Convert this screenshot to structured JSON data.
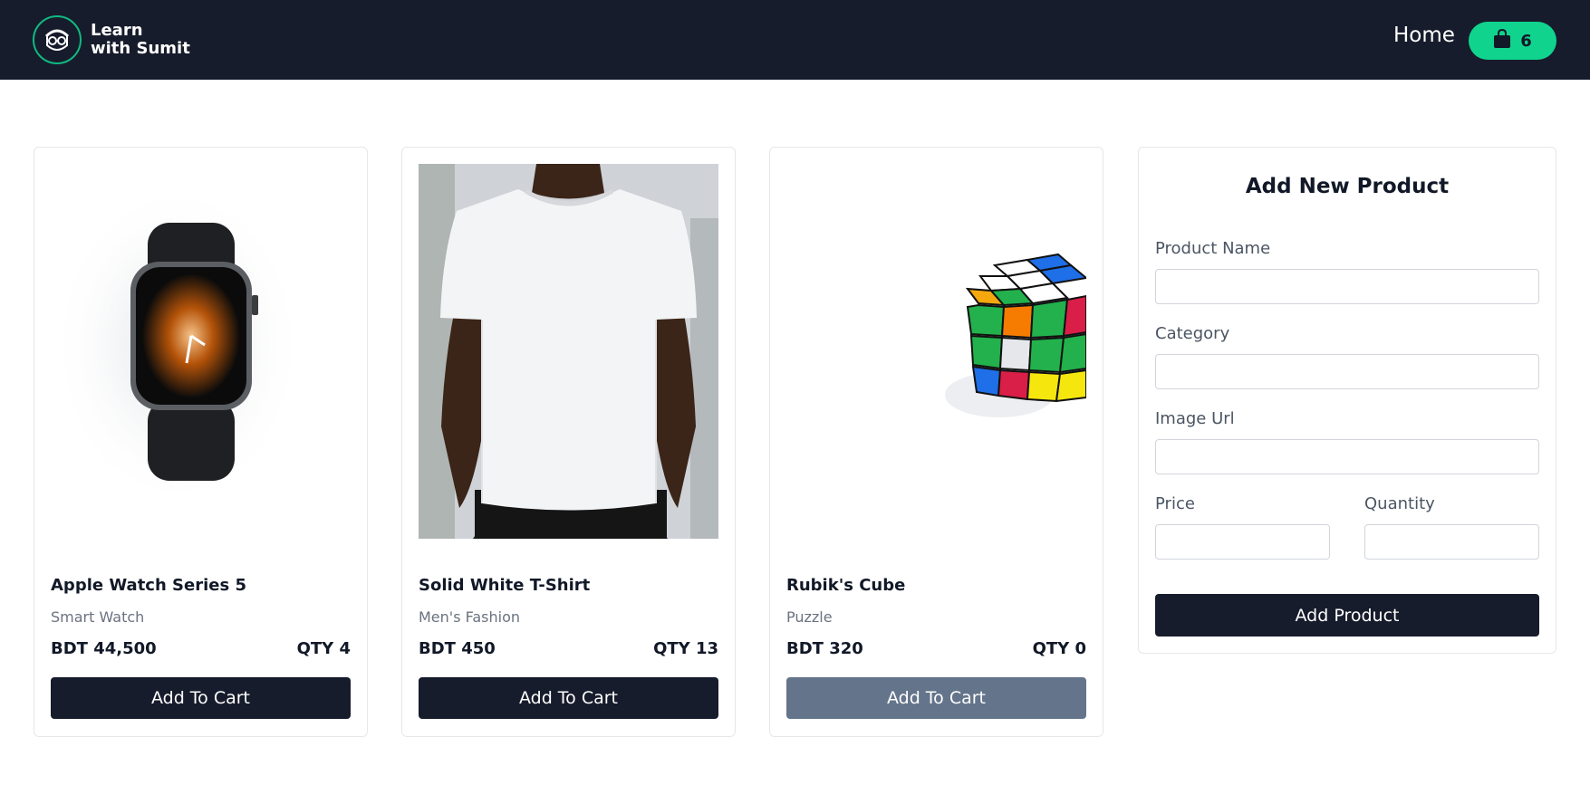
{
  "brand": {
    "name_line1": "Learn",
    "name_line2": "with Sumit",
    "accent_color": "#10b981"
  },
  "nav": {
    "home_label": "Home",
    "cart_icon": "shopping-bag-icon",
    "cart_count": "6"
  },
  "products": [
    {
      "title": "Apple Watch Series 5",
      "category": "Smart Watch",
      "price": "BDT 44,500",
      "qty": "QTY 4",
      "button_label": "Add To Cart",
      "image": "smartwatch-image",
      "disabled": false
    },
    {
      "title": "Solid White T-Shirt",
      "category": "Men's Fashion",
      "price": "BDT 450",
      "qty": "QTY 13",
      "button_label": "Add To Cart",
      "image": "tshirt-image",
      "disabled": false
    },
    {
      "title": "Rubik's Cube",
      "category": "Puzzle",
      "price": "BDT 320",
      "qty": "QTY 0",
      "button_label": "Add To Cart",
      "image": "rubiks-cube-image",
      "disabled": true
    }
  ],
  "form": {
    "title": "Add New Product",
    "product_name_label": "Product Name",
    "product_name_value": "",
    "category_label": "Category",
    "category_value": "",
    "image_url_label": "Image Url",
    "image_url_value": "",
    "price_label": "Price",
    "price_value": "",
    "quantity_label": "Quantity",
    "quantity_value": "",
    "submit_label": "Add Product"
  },
  "colors": {
    "navbar": "#171c2c",
    "cart_button": "#10d48e",
    "primary_button": "#171c2c",
    "disabled_button": "#64748b"
  }
}
